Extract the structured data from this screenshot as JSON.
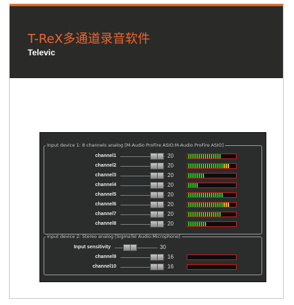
{
  "header": {
    "title": "T-ReX多通道录音软件",
    "subtitle": "Televic"
  },
  "mixer": {
    "group1": {
      "legend": "Input device 1: 8 channels analog [M-Audio ProFire ASIO:M-Audio ProFire ASIO]",
      "channels": [
        {
          "label": "channel1",
          "value": "20",
          "level": 0.7
        },
        {
          "label": "channel2",
          "value": "20",
          "level": 0.85
        },
        {
          "label": "channel3",
          "value": "20",
          "level": 0.35
        },
        {
          "label": "channel4",
          "value": "20",
          "level": 0.2
        },
        {
          "label": "channel5",
          "value": "20",
          "level": 0.72
        },
        {
          "label": "channel6",
          "value": "20",
          "level": 0.88
        },
        {
          "label": "channel7",
          "value": "20",
          "level": 0.7
        },
        {
          "label": "channel8",
          "value": "20",
          "level": 0.4
        }
      ]
    },
    "group2": {
      "legend": "Input device 2: Stereo analog [SigmaTel Audio:Microphone]",
      "sensitivity": {
        "label": "Input sensitivity",
        "value": "30"
      },
      "channels": [
        {
          "label": "channel9",
          "value": "16",
          "level": 0.0
        },
        {
          "label": "channel10",
          "value": "16",
          "level": 0.0
        }
      ]
    }
  },
  "colors": {
    "accent": "#f0652a",
    "header_bg": "#2a2a28",
    "meter_green": "#2fd02a",
    "meter_yellow": "#e8d21a",
    "meter_border": "#d01818"
  }
}
